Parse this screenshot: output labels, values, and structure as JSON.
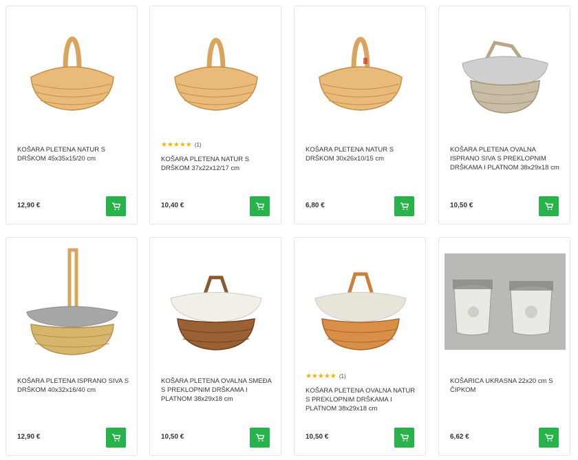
{
  "products": [
    {
      "title": "KOŠARA PLETENA NATUR S DRŠKOM 45x35x15/20 cm",
      "price": "12,90 €",
      "rating": null,
      "image": "wicker-basket-handle"
    },
    {
      "title": "KOŠARA PLETENA NATUR S DRŠKOM 37x22x12/17 cm",
      "price": "10,40 €",
      "rating": {
        "stars": "★★★★★",
        "count": "(1)"
      },
      "image": "wicker-basket-handle"
    },
    {
      "title": "KOŠARA PLETENA NATUR S DRŠKOM 30x26x10/15 cm",
      "price": "6,80 €",
      "rating": null,
      "image": "wicker-basket-handle"
    },
    {
      "title": "KOŠARA PLETENA OVALNA ISPRANO SIVA S PREKLOPNIM DRŠKAMA I PLATNOM 38x29x18 cm",
      "price": "10,50 €",
      "rating": null,
      "image": "grey-basket-cloth"
    },
    {
      "title": "KOŠARA PLETENA ISPRANO SIVA S DRŠKOM 40x32x16/40 cm",
      "price": "12,90 €",
      "rating": null,
      "image": "tall-handle-basket-grey-cloth"
    },
    {
      "title": "KOŠARA PLETENA OVALNA SMEĐA S PREKLOPNIM DRŠKAMA I PLATNOM 38x29x18 cm",
      "price": "10,50 €",
      "rating": null,
      "image": "brown-basket-cloth"
    },
    {
      "title": "KOŠARA PLETENA OVALNA NATUR S PREKLOPNIM DRŠKAMA I PLATNOM 38x29x18 cm",
      "price": "10,50 €",
      "rating": {
        "stars": "★★★★★",
        "count": "(1)"
      },
      "image": "natural-basket-cloth"
    },
    {
      "title": "KOŠARICA UKRASNA 22x20 cm S ČIPKOM",
      "price": "6,62 €",
      "rating": null,
      "image": "decorative-pots"
    }
  ],
  "colors": {
    "accent": "#27b24a",
    "star": "#f5b301"
  },
  "icons": {
    "cart": "shopping-cart-icon"
  }
}
